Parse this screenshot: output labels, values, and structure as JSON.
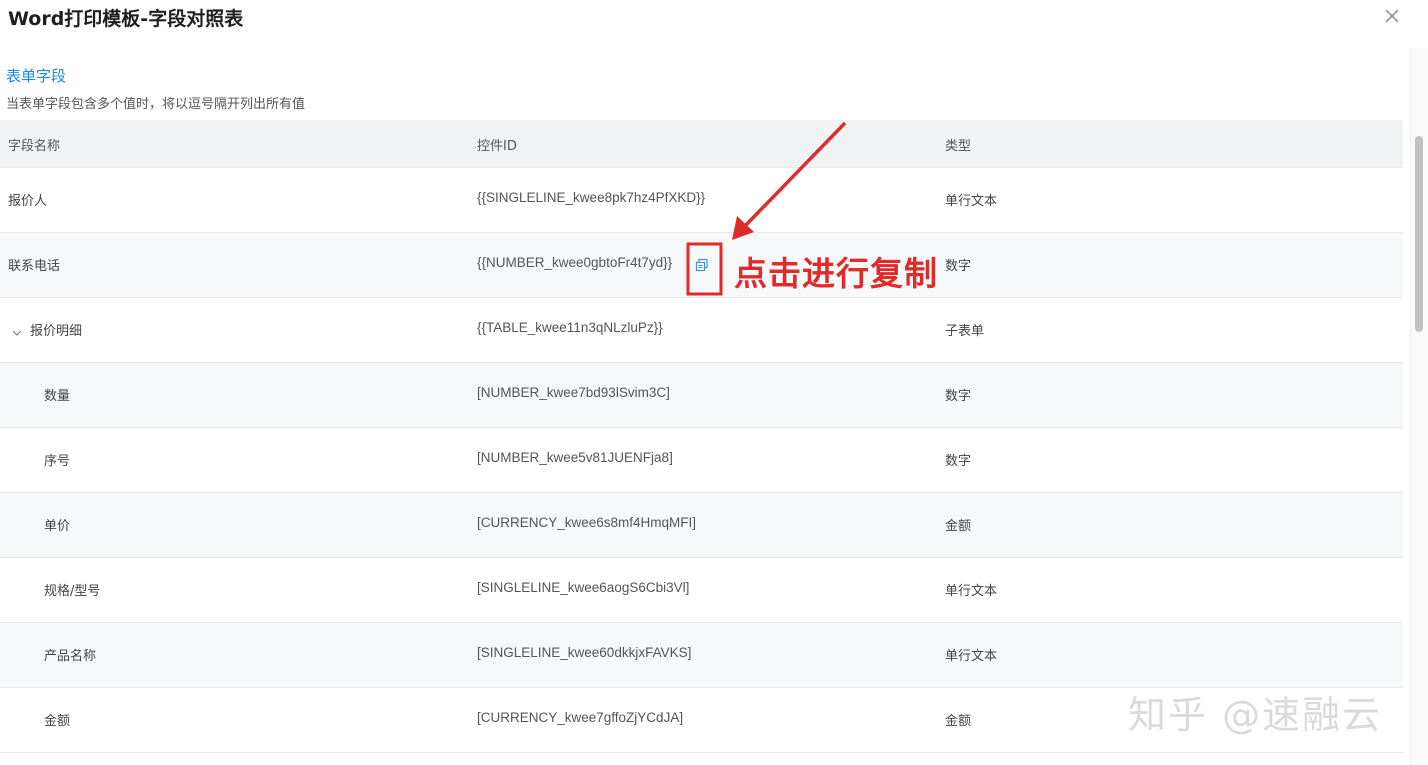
{
  "dialog": {
    "title": "Word打印模板-字段对照表",
    "close_icon": "close-icon"
  },
  "section": {
    "title": "表单字段",
    "description": "当表单字段包含多个值时，将以逗号隔开列出所有值"
  },
  "table": {
    "headers": [
      "字段名称",
      "控件ID",
      "类型"
    ],
    "rows": [
      {
        "name": "报价人",
        "id": "{{SINGLELINE_kwee8pk7hz4PfXKD}}",
        "type": "单行文本"
      },
      {
        "name": "联系电话",
        "id": "{{NUMBER_kwee0gbtoFr4t7yd}}",
        "type": "数字",
        "copy_icon": "copy-icon"
      },
      {
        "name": "报价明细",
        "id": "{{TABLE_kwee11n3qNLzluPz}}",
        "type": "子表单",
        "expand_icon": "chevron-down-icon"
      },
      {
        "name": "数量",
        "id": "[NUMBER_kwee7bd93lSvim3C]",
        "type": "数字"
      },
      {
        "name": "序号",
        "id": "[NUMBER_kwee5v81JUENFja8]",
        "type": "数字"
      },
      {
        "name": "单价",
        "id": "[CURRENCY_kwee6s8mf4HmqMFI]",
        "type": "金额"
      },
      {
        "name": "规格/型号",
        "id": "[SINGLELINE_kwee6aogS6Cbi3Vl]",
        "type": "单行文本"
      },
      {
        "name": "产品名称",
        "id": "[SINGLELINE_kwee60dkkjxFAVKS]",
        "type": "单行文本"
      },
      {
        "name": "金额",
        "id": "[CURRENCY_kwee7gffoZjYCdJA]",
        "type": "金额"
      }
    ]
  },
  "annotation": {
    "text": "点击进行复制",
    "color": "#e02b2b"
  },
  "watermark": {
    "text": "知乎 @速融云"
  },
  "colors": {
    "accent": "#1a8bd6",
    "header_bg": "#f1f2f4",
    "alt_row_bg": "#f7f8fa"
  }
}
